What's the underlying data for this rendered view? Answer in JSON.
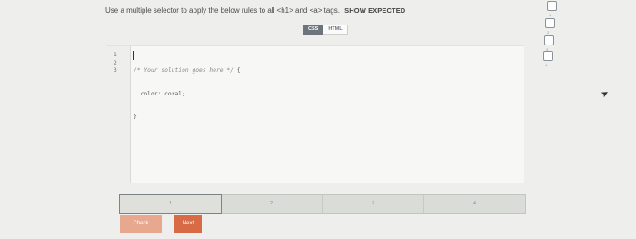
{
  "instruction": {
    "text": "Use a multiple selector to apply the below rules to all <h1> and <a> tags.",
    "show_expected": "SHOW EXPECTED"
  },
  "tabs": {
    "css": "CSS",
    "html": "HTML",
    "active": "CSS"
  },
  "editor": {
    "line_numbers": [
      "1",
      "2",
      "3"
    ],
    "lines": [
      {
        "comment": "/* Your solution goes here */",
        "code": " {"
      },
      {
        "comment": "",
        "code": "  color: coral;"
      },
      {
        "comment": "",
        "code": "}"
      }
    ]
  },
  "results": {
    "cells": [
      {
        "label": "1",
        "active": true
      },
      {
        "label": "2",
        "active": false
      },
      {
        "label": "3",
        "active": false
      },
      {
        "label": "4",
        "active": false
      }
    ]
  },
  "buttons": {
    "check": "Check",
    "next": "Next"
  },
  "progress": {
    "steps": [
      {
        "label": "1"
      },
      {
        "label": "2"
      },
      {
        "label": "3"
      },
      {
        "label": "4"
      }
    ]
  },
  "colors": {
    "check_button": "#e7a88f",
    "next_button": "#d86a45",
    "css_tab": "#6d747c",
    "background": "#eeeeec"
  }
}
